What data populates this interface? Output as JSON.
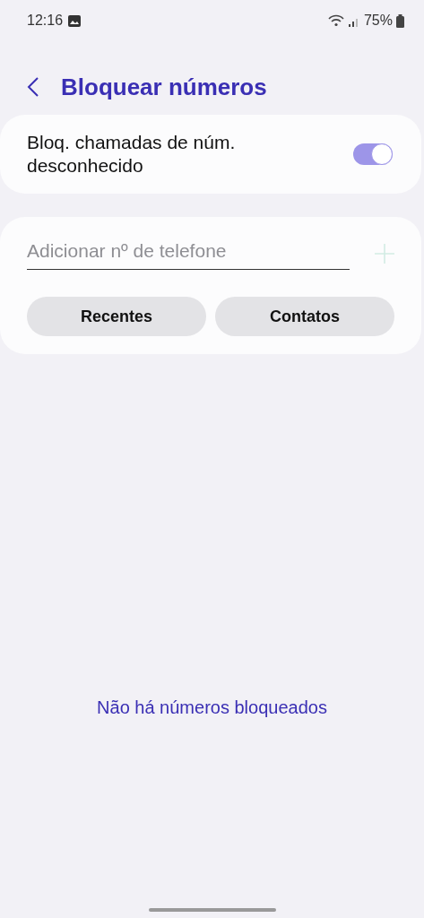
{
  "status_bar": {
    "time": "12:16",
    "battery": "75%"
  },
  "header": {
    "title": "Bloquear números"
  },
  "block_unknown": {
    "label": "Bloq. chamadas de núm. desconhecido",
    "on": true
  },
  "add_number": {
    "placeholder": "Adicionar nº de telefone",
    "buttons": [
      "Recentes",
      "Contatos"
    ]
  },
  "empty_message": "Não há números bloqueados"
}
